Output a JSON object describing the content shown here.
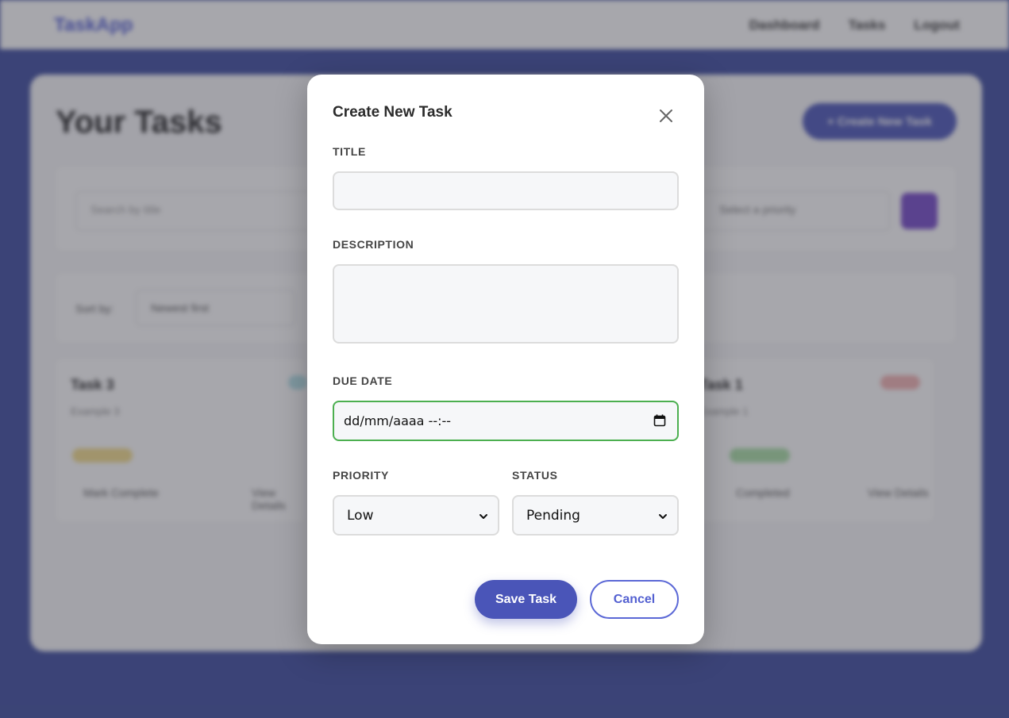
{
  "background": {
    "brand": "TaskApp",
    "nav": [
      "Dashboard",
      "Tasks",
      "Logout"
    ],
    "page_title": "Your Tasks",
    "create_button": "+ Create New Task",
    "search_placeholder": "Search by title",
    "priority_placeholder": "Select a priority",
    "sort_label": "Sort by:",
    "sort_value": "Newest first",
    "tasks": [
      {
        "title": "Task 3",
        "subtitle": "Example 3",
        "action_left": "Mark Complete",
        "action_right": "View Details"
      },
      {
        "title": "Task 1",
        "subtitle": "Example 1",
        "action_left": "Completed",
        "action_right": "View Details"
      }
    ]
  },
  "modal": {
    "title": "Create New Task",
    "close_icon": "close-icon",
    "fields": {
      "title_label": "TITLE",
      "title_value": "",
      "description_label": "DESCRIPTION",
      "description_value": "",
      "due_date_label": "DUE DATE",
      "due_date_value": "dd/mm/aaaa --:--",
      "priority_label": "PRIORITY",
      "priority_value": "Low",
      "status_label": "STATUS",
      "status_value": "Pending"
    },
    "save_button": "Save Task",
    "cancel_button": "Cancel"
  },
  "colors": {
    "accent": "#4a55b8",
    "date_focus_border": "#4caf50",
    "backdrop": "#3b4a9e"
  }
}
